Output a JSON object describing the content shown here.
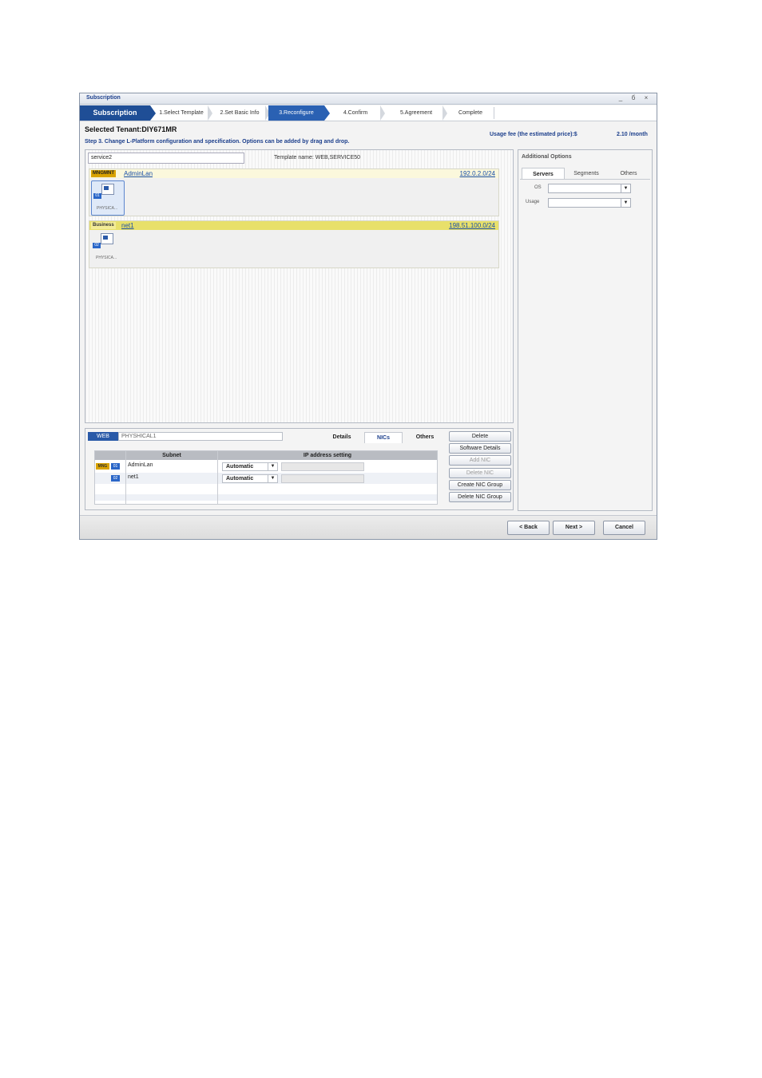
{
  "window": {
    "title": "Subscription",
    "controls": {
      "minimize": "_",
      "restore": "б",
      "close": "×"
    }
  },
  "wizard": {
    "brand": "Subscription",
    "steps": [
      "1.Select Template",
      "2.Set Basic Info",
      "3.Reconfigure",
      "4.Confirm",
      "5.Agreement",
      "Complete"
    ],
    "active_step": 2
  },
  "header": {
    "tenant": "Selected Tenant:DIY671MR",
    "step_description": "Step 3. Change L-Platform configuration and specification. Options can be added by drag and drop.",
    "usage_label": "Usage fee (the estimated price):$",
    "usage_value": "2.10 /month"
  },
  "canvas": {
    "service_name": "service2",
    "template_name": "Template name: WEB,SERVICE50",
    "segments": [
      {
        "tag": "MNGMNT",
        "name": "AdminLan",
        "ip": "192.0.2.0/24",
        "server_label": "PHYSICA...",
        "nic": "01"
      },
      {
        "tag": "Business",
        "name": "net1",
        "ip": "198.51.100.0/24",
        "server_label": "PHYSICA...",
        "nic": "02"
      }
    ]
  },
  "details": {
    "server_tag": "WEB",
    "server_name": "PHYSHICAL1",
    "tabs": [
      "Details",
      "NICs",
      "Others"
    ],
    "active_tab": 1,
    "table": {
      "headers": [
        "Subnet",
        "IP address setting"
      ],
      "rows": [
        {
          "tag": "MNG",
          "nic": "01",
          "subnet": "AdminLan",
          "ip_setting": "Automatic"
        },
        {
          "tag": "",
          "nic": "02",
          "subnet": "net1",
          "ip_setting": "Automatic"
        }
      ]
    },
    "actions": [
      "Delete",
      "Software Details",
      "Add NIC",
      "Delete NIC",
      "Create NIC Group",
      "Delete NIC Group"
    ]
  },
  "additional_options": {
    "title": "Additional Options",
    "tabs": [
      "Servers",
      "Segments",
      "Others"
    ],
    "active_tab": 0,
    "fields": [
      {
        "label": "OS",
        "value": ""
      },
      {
        "label": "Usage",
        "value": ""
      }
    ]
  },
  "footer": {
    "back": "< Back",
    "next": "Next >",
    "cancel": "Cancel"
  },
  "colors": {
    "brand_blue": "#1f4e96",
    "active_step": "#2a61b3",
    "mngmnt_tag": "#d9a300",
    "business_bar": "#e8e06a",
    "link": "#1a4fa8"
  }
}
